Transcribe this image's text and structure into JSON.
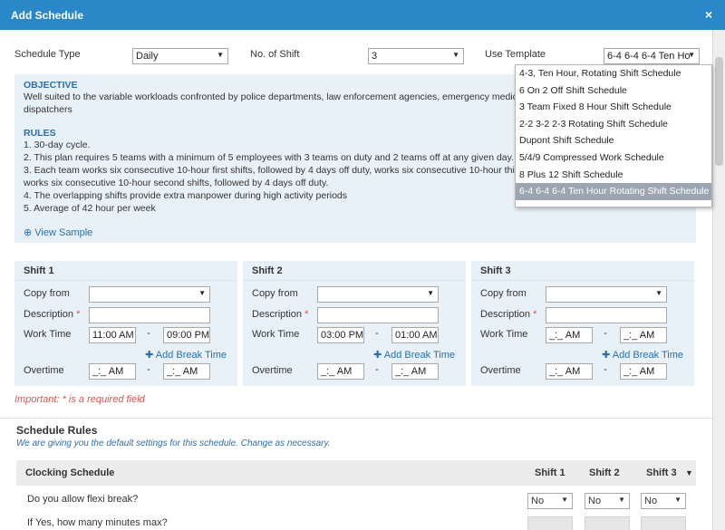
{
  "window": {
    "title": "Add Schedule",
    "close": "×"
  },
  "top_form": {
    "schedule_type_label": "Schedule Type",
    "schedule_type_value": "Daily",
    "no_of_shift_label": "No. of Shift",
    "no_of_shift_value": "3",
    "use_template_label": "Use Template",
    "use_template_value": "6-4 6-4 6-4 Ten Ho"
  },
  "template_options": [
    "4-3, Ten Hour, Rotating Shift Schedule",
    "6 On 2 Off Shift Schedule",
    "3 Team Fixed 8 Hour Shift Schedule",
    "2-2 3-2 2-3 Rotating Shift Schedule",
    "Dupont Shift Schedule",
    "5/4/9 Compressed Work Schedule",
    "8 Plus 12 Shift Schedule",
    "6-4 6-4 6-4 Ten Hour Rotating Shift Schedule"
  ],
  "info": {
    "objective_heading": "OBJECTIVE",
    "objective_line1": "Well suited to the variable workloads confronted by police departments, law enforcement agencies, emergency medic",
    "objective_line2": "dispatchers",
    "rules_heading": "RULES",
    "rules": [
      "1. 30-day cycle.",
      "2. This plan requires 5 teams with a minimum of 5 employees with 3 teams on duty and 2 teams off at any given day.",
      "3. Each team works six consecutive 10-hour first shifts, followed by 4 days off duty, works six consecutive 10-hour thi",
      "works six consecutive 10-hour second shifts, followed by 4 days off duty.",
      "4. The overlapping shifts provide extra manpower during high activity periods",
      "5. Average of 42 hour per week"
    ],
    "view_sample": "View Sample"
  },
  "shift_labels": {
    "copy_from": "Copy from",
    "description": "Description",
    "required_mark": "*",
    "work_time": "Work Time",
    "overtime": "Overtime",
    "add_break": "Add Break Time",
    "dash": "-"
  },
  "shifts": [
    {
      "title": "Shift 1",
      "work_start": "11:00 AM",
      "work_end": "09:00 PM",
      "ot_start": "_:_ AM",
      "ot_end": "_:_ AM"
    },
    {
      "title": "Shift 2",
      "work_start": "03:00 PM",
      "work_end": "01:00 AM",
      "ot_start": "_:_ AM",
      "ot_end": "_:_ AM"
    },
    {
      "title": "Shift 3",
      "work_start": "_:_ AM",
      "work_end": "_:_ AM",
      "ot_start": "_:_ AM",
      "ot_end": "_:_ AM"
    }
  ],
  "important_note": "Important: * is a required field",
  "schedule_rules": {
    "title": "Schedule Rules",
    "subtitle": "We are giving you the default settings for this schedule. Change as necessary.",
    "section": "Clocking Schedule",
    "col1": "Shift 1",
    "col2": "Shift 2",
    "col3": "Shift 3",
    "q1": "Do you allow flexi break?",
    "q1_values": [
      "No",
      "No",
      "No"
    ],
    "q2": "If Yes, how many minutes max?"
  },
  "colors": {
    "titlebar": "#2a87c8",
    "panel": "#e8f1f8",
    "accent": "#2a6fa8",
    "required": "#d9534f"
  }
}
